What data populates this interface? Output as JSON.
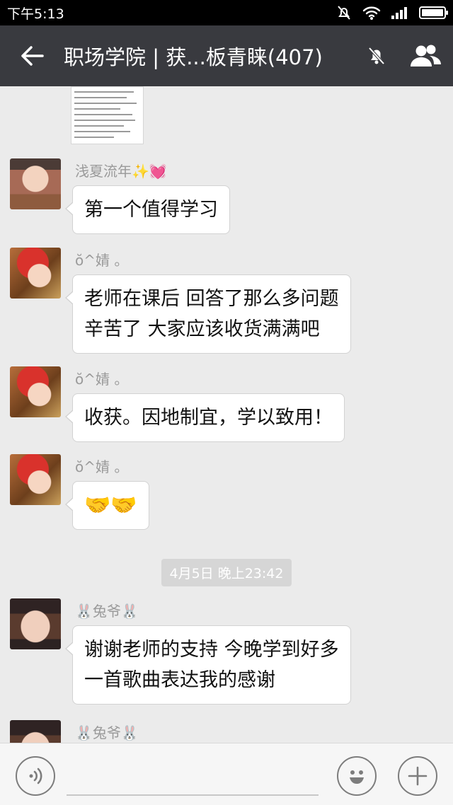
{
  "status_bar": {
    "time": "下午5:13"
  },
  "header": {
    "title": "职场学院 | 获...板青睐(407)"
  },
  "messages": [
    {
      "sender": "浅夏流年",
      "sender_extra": [
        "✨",
        "💓"
      ],
      "lines": [
        "第一个值得学习"
      ]
    },
    {
      "sender": "ŏ^婧 。",
      "lines": [
        "老师在课后 回答了那么多问题",
        "辛苦了 大家应该收货满满吧"
      ]
    },
    {
      "sender": "ŏ^婧 。",
      "lines": [
        "收获。因地制宜，学以致用！"
      ]
    },
    {
      "sender": "ŏ^婧 。",
      "lines": [
        "🤝🤝"
      ]
    },
    {
      "sender_prefix": "🐰",
      "sender": "兔爷",
      "sender_suffix": "🐰",
      "lines": [
        "谢谢老师的支持 今晚学到好多",
        "一首歌曲表达我的感谢"
      ]
    },
    {
      "sender_prefix": "🐰",
      "sender": "兔爷",
      "sender_suffix": "🐰",
      "lines": []
    }
  ],
  "timestamp": "4月5日 晚上23:42",
  "colors": {
    "header_bg": "#393a3f",
    "chat_bg": "#ebebeb",
    "bubble_bg": "#ffffff"
  },
  "icons": [
    "back-arrow-icon",
    "mute-bell-icon",
    "members-icon",
    "voice-icon",
    "emoji-icon",
    "plus-icon",
    "wifi-icon",
    "signal-icon",
    "battery-icon"
  ]
}
